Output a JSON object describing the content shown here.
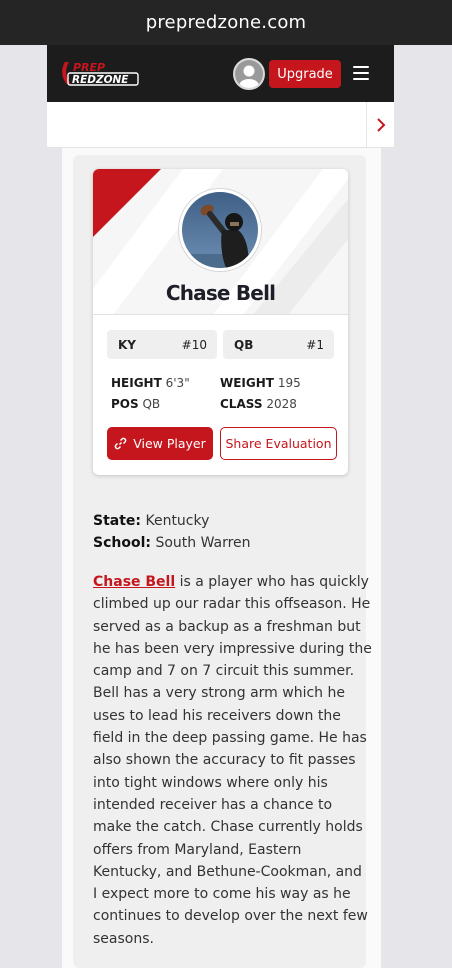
{
  "browser": {
    "url": "prepredzone.com"
  },
  "nav": {
    "logo_top": "PREP",
    "logo_bottom": "REDZONE",
    "upgrade_label": "Upgrade",
    "menu_icon": "hamburger-icon",
    "avatar_icon": "user-avatar-icon"
  },
  "subnav": {
    "chevron_icon": "chevron-right-icon"
  },
  "player_card": {
    "name": "Chase Bell",
    "state_abbr": "KY",
    "number": "#10",
    "position_abbr": "QB",
    "rank": "#1",
    "height_label": "HEIGHT",
    "height": "6'3\"",
    "weight_label": "WEIGHT",
    "weight": "195",
    "pos_label": "POS",
    "pos": "QB",
    "class_label": "CLASS",
    "class": "2028",
    "view_button": "View Player",
    "share_button": "Share Evaluation"
  },
  "details": {
    "state_label": "State:",
    "state": "Kentucky",
    "school_label": "School:",
    "school": "South Warren"
  },
  "article": {
    "link_text": "Chase Bell",
    "lines": [
      " is a player who has quickly",
      "climbed up our radar this offseason. He",
      "served as a backup as a freshman but",
      "he has been very impressive during the",
      "camp and 7 on 7 circuit this summer.",
      "Bell has a very strong arm which he",
      "uses to lead his receivers down the",
      "field in the deep passing game. He has",
      "also shown the accuracy to fit passes",
      "into tight windows where only his",
      "intended receiver has a chance to",
      "make the catch. Chase currently holds",
      "offers from Maryland, Eastern",
      "Kentucky, and Bethune-Cookman, and",
      "I expect more to come his way as he",
      "continues to develop over the next few",
      "seasons."
    ]
  },
  "colors": {
    "brand_red": "#c5161d",
    "nav_dark": "#1c1c1c"
  }
}
